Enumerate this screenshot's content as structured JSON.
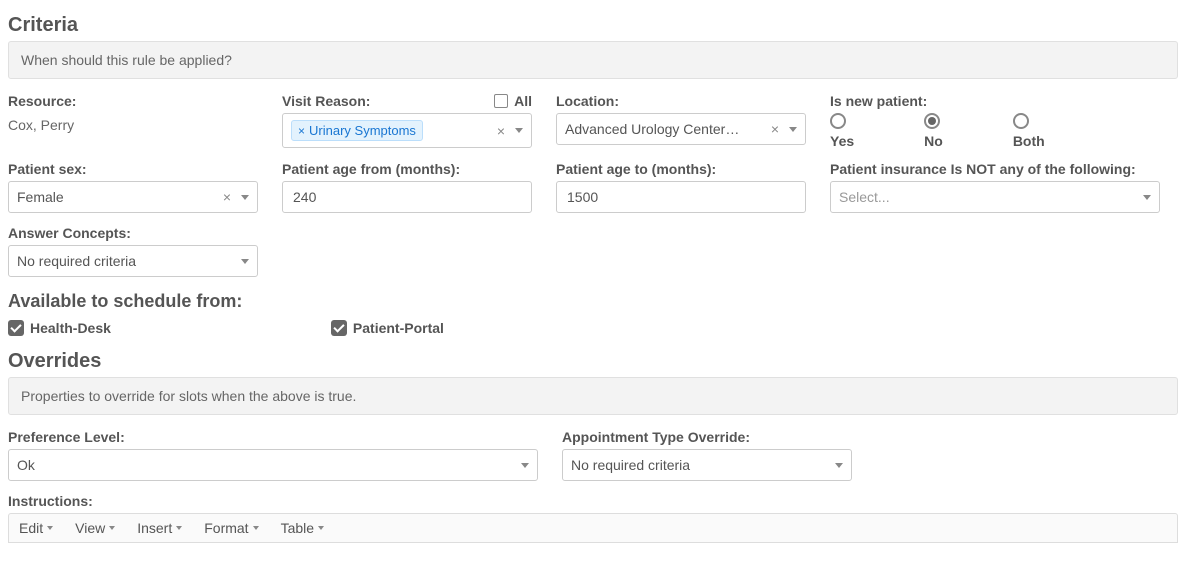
{
  "criteria": {
    "title": "Criteria",
    "desc": "When should this rule be applied?",
    "resource": {
      "label": "Resource:",
      "value": "Cox, Perry"
    },
    "visitReason": {
      "label": "Visit Reason:",
      "allLabel": "All",
      "tag": "Urinary Symptoms"
    },
    "location": {
      "label": "Location:",
      "value": "Advanced Urology Centers Of ..."
    },
    "newPatient": {
      "label": "Is new patient:",
      "options": {
        "yes": "Yes",
        "no": "No",
        "both": "Both"
      },
      "selected": "no"
    },
    "sex": {
      "label": "Patient sex:",
      "value": "Female"
    },
    "ageFrom": {
      "label": "Patient age from (months):",
      "value": "240"
    },
    "ageTo": {
      "label": "Patient age to (months):",
      "value": "1500"
    },
    "insurance": {
      "label": "Patient insurance Is NOT any of the following:",
      "placeholder": "Select..."
    },
    "answerConcepts": {
      "label": "Answer Concepts:",
      "value": "No required criteria"
    },
    "availableTitle": "Available to schedule from:",
    "healthDesk": "Health-Desk",
    "patientPortal": "Patient-Portal"
  },
  "overrides": {
    "title": "Overrides",
    "desc": "Properties to override for slots when the above is true.",
    "preference": {
      "label": "Preference Level:",
      "value": "Ok"
    },
    "apptType": {
      "label": "Appointment Type Override:",
      "value": "No required criteria"
    },
    "instructionsLabel": "Instructions:",
    "toolbar": {
      "edit": "Edit",
      "view": "View",
      "insert": "Insert",
      "format": "Format",
      "table": "Table"
    }
  }
}
